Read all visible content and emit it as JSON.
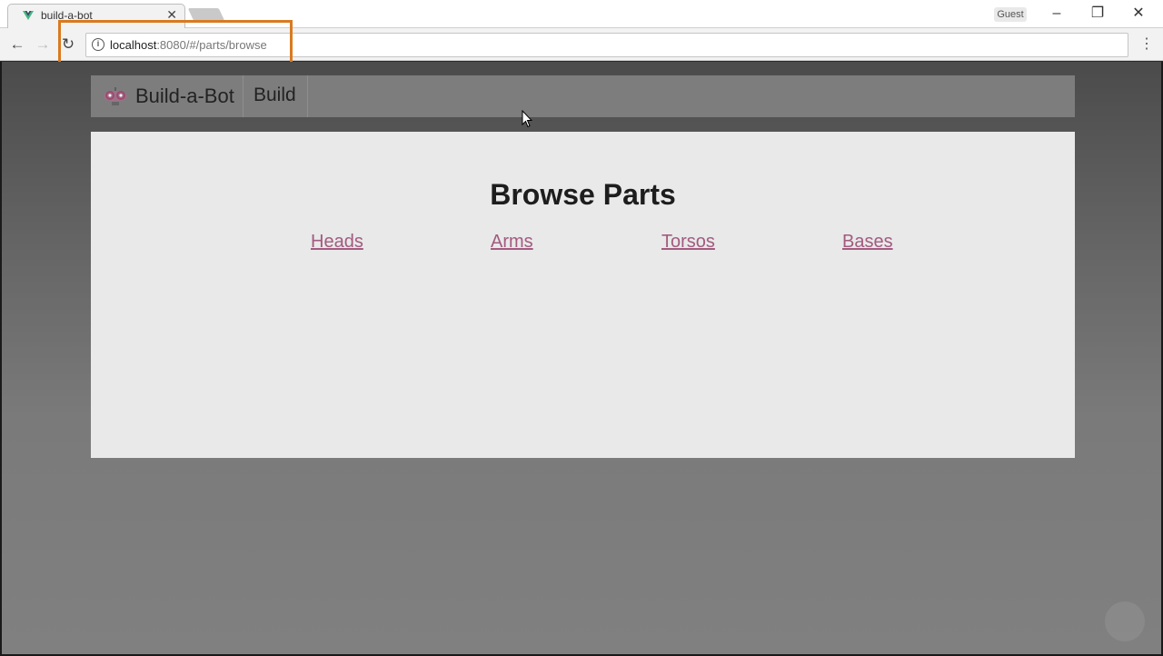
{
  "browser": {
    "tab_title": "build-a-bot",
    "profile_label": "Guest",
    "url_host": "localhost",
    "url_rest": ":8080/#/parts/browse"
  },
  "header": {
    "brand": "Build-a-Bot",
    "nav_build": "Build"
  },
  "content": {
    "title": "Browse Parts",
    "links": [
      "Heads",
      "Arms",
      "Torsos",
      "Bases"
    ]
  },
  "colors": {
    "highlight": "#d97a1f",
    "link": "#a25b7f",
    "vue_green": "#41b883"
  }
}
